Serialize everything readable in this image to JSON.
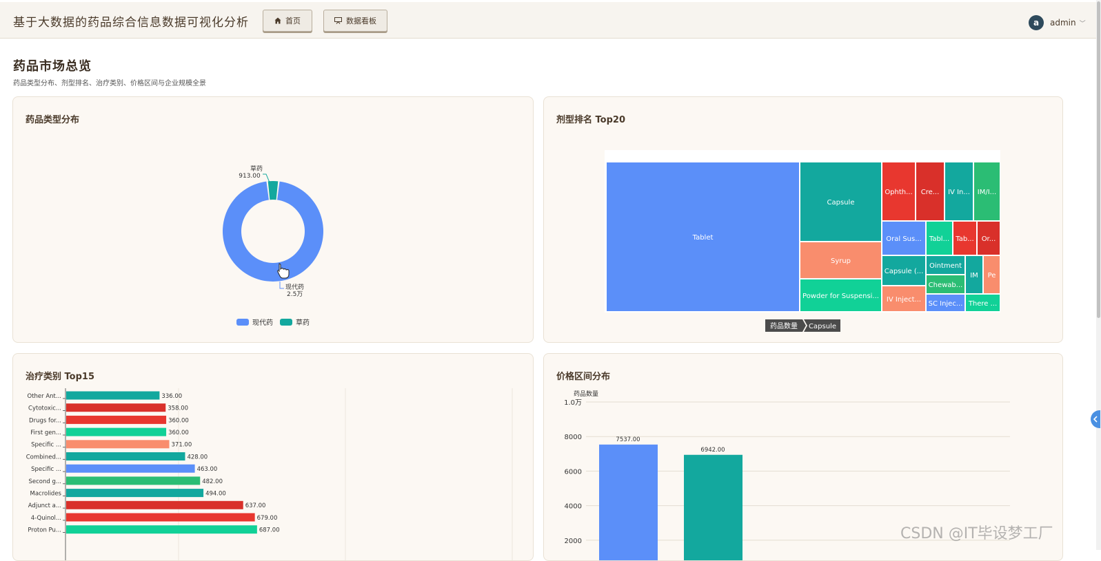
{
  "app": {
    "title": "基于大数据的药品综合信息数据可视化分析"
  },
  "nav": {
    "home": "首页",
    "dashboard": "数据看板"
  },
  "user": {
    "initial": "a",
    "name": "admin"
  },
  "page": {
    "title": "药品市场总览",
    "subtitle": "药品类型分布、剂型排名、治疗类别、价格区间与企业规模全景"
  },
  "colors": {
    "blue": "#5b8ff9",
    "teal": "#13a89e",
    "red": "#e8372f",
    "darkred": "#d9302a",
    "green": "#2bbd74",
    "mint": "#11d197",
    "salmon": "#f98d6d"
  },
  "card1": {
    "title": "药品类型分布",
    "chart_data": {
      "type": "pie",
      "slices": [
        {
          "name": "现代药",
          "value": 25000,
          "label": "2.5万",
          "color": "#5b8ff9"
        },
        {
          "name": "草药",
          "value": 913,
          "label": "913.00",
          "color": "#13a89e"
        }
      ],
      "legend": [
        "现代药",
        "草药"
      ]
    }
  },
  "card2": {
    "title": "剂型排名 Top20",
    "breadcrumb": [
      "药品数量",
      "Capsule"
    ],
    "chart_data": {
      "type": "treemap",
      "items": [
        "Tablet",
        "Capsule",
        "Syrup",
        "Powder for Suspensi...",
        "Ophth...",
        "Cre...",
        "IV In...",
        "IM/I...",
        "Oral Sus...",
        "Tabl...",
        "Tab...",
        "Or...",
        "Capsule (...",
        "Ointment",
        "Chewab...",
        "IM",
        "Pe",
        "IV Inject...",
        "SC Injec...",
        "There ..."
      ]
    }
  },
  "card3": {
    "title": "治疗类别 Top15",
    "chart_data": {
      "type": "bar",
      "orientation": "horizontal",
      "categories": [
        "Other Ant...",
        "Cytotoxic...",
        "Drugs for...",
        "First gen...",
        "Specific ...",
        "Combined...",
        "Specific ...",
        "Second g...",
        "Macrolides",
        "Adjunct a...",
        "4-Quinol...",
        "Proton Pu..."
      ],
      "values": [
        336,
        358,
        360,
        360,
        371,
        428,
        463,
        482,
        494,
        637,
        679,
        687
      ],
      "value_labels": [
        "336.00",
        "358.00",
        "360.00",
        "360.00",
        "371.00",
        "428.00",
        "463.00",
        "482.00",
        "494.00",
        "637.00",
        "679.00",
        "687.00"
      ],
      "colors": [
        "#13a89e",
        "#d9302a",
        "#e8372f",
        "#11d197",
        "#f98d6d",
        "#13a89e",
        "#5b8ff9",
        "#2bbd74",
        "#13a89e",
        "#d9302a",
        "#e8372f",
        "#11d197"
      ],
      "xlim": [
        0,
        2500
      ]
    }
  },
  "card4": {
    "title": "价格区间分布",
    "chart_data": {
      "type": "bar",
      "ylabel": "药品数量",
      "yticks": [
        "2000",
        "4000",
        "6000",
        "8000",
        "1.0万"
      ],
      "ytick_values": [
        2000,
        4000,
        6000,
        8000,
        10000
      ],
      "values": [
        7537,
        6942
      ],
      "value_labels": [
        "7537.00",
        "6942.00"
      ],
      "colors": [
        "#5b8ff9",
        "#13a89e"
      ],
      "ylim": [
        0,
        10000
      ]
    }
  },
  "watermark": "CSDN @IT毕设梦工厂"
}
